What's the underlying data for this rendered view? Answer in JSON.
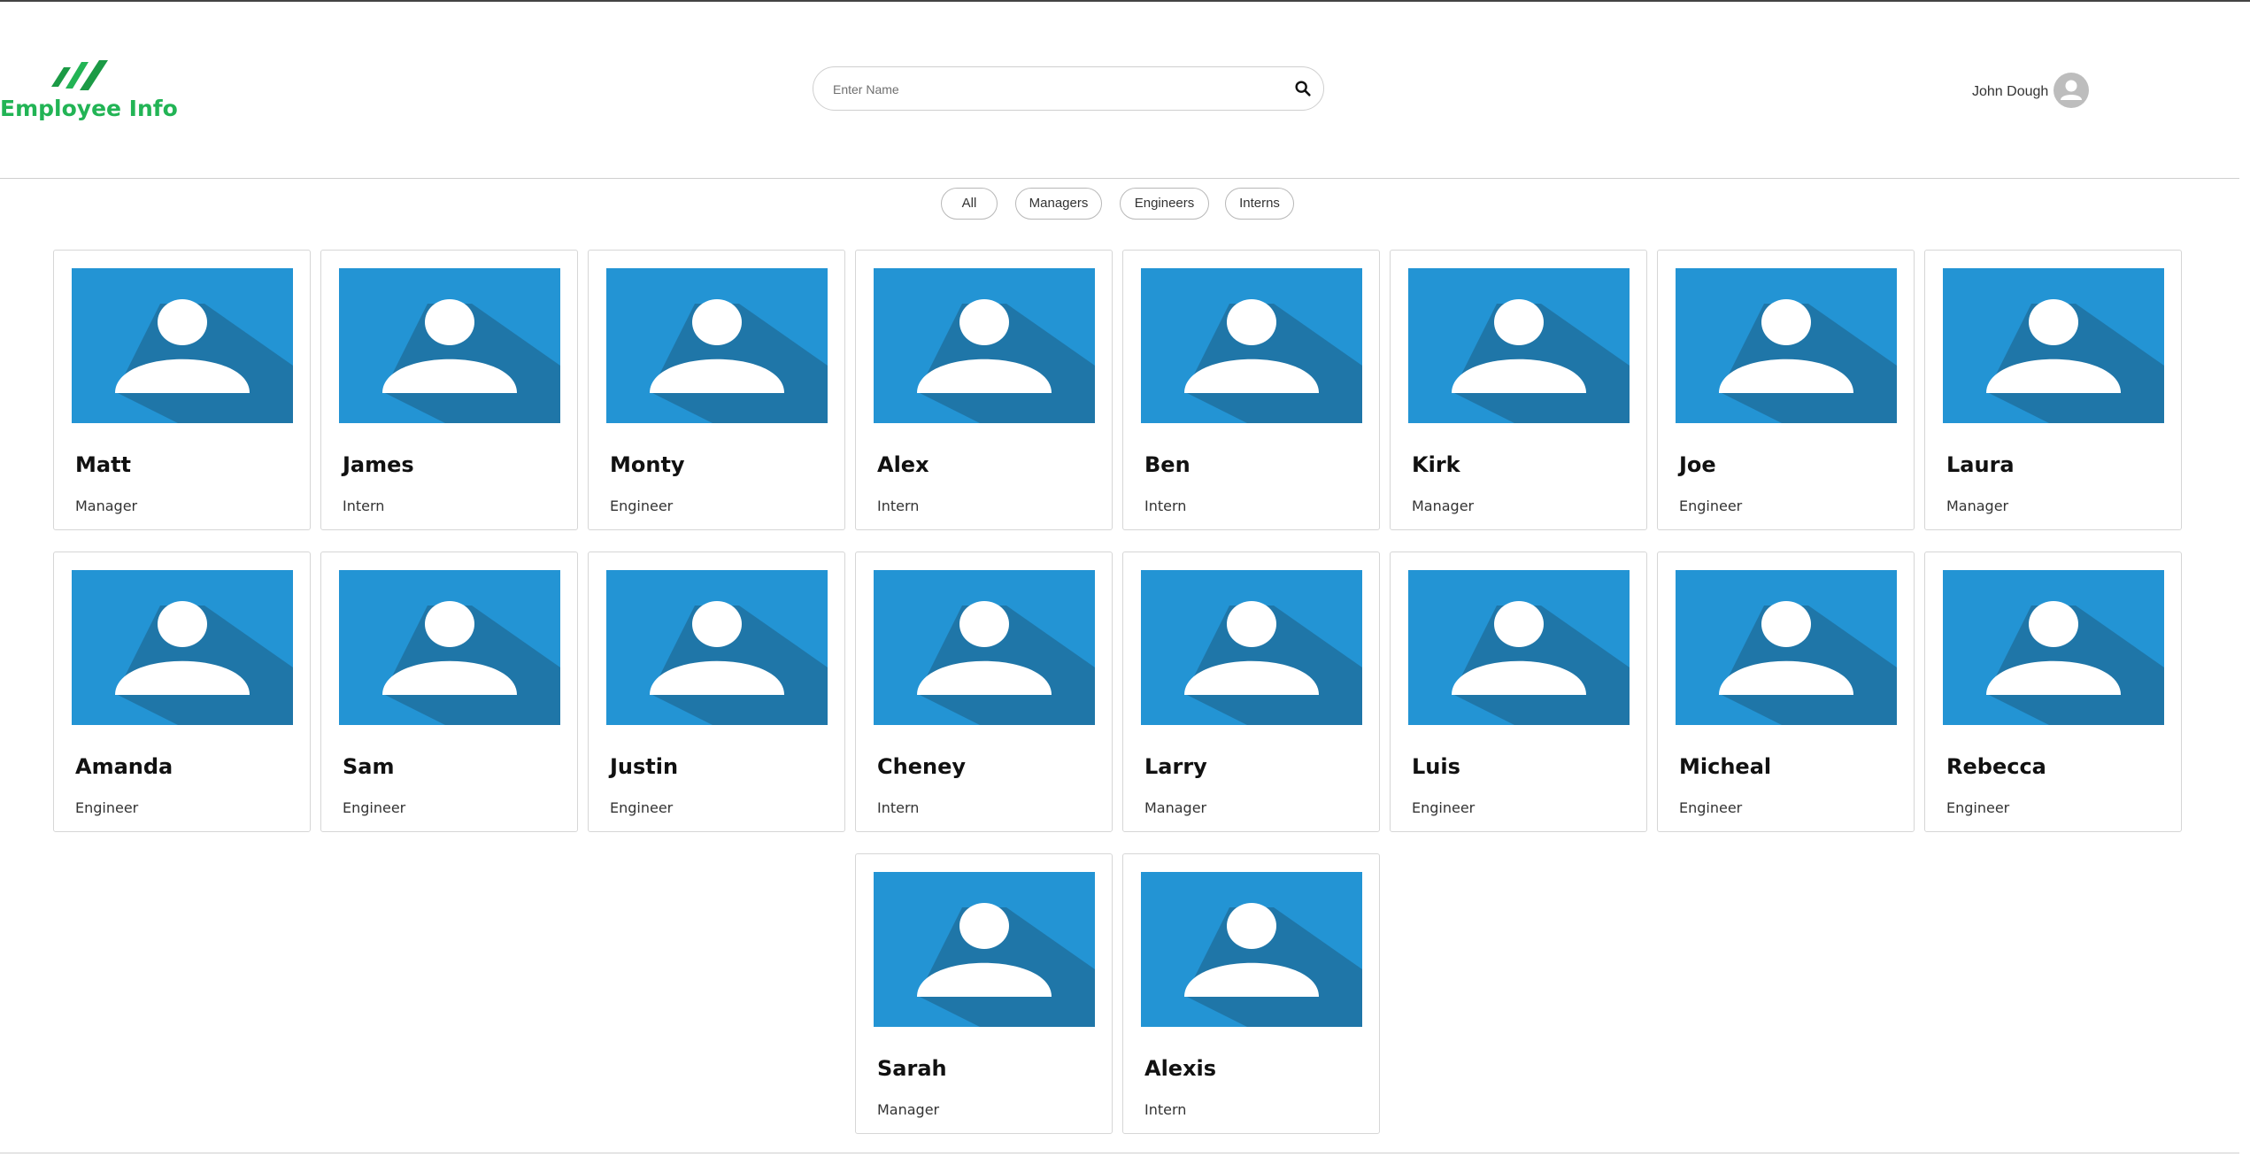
{
  "header": {
    "brand": "Employee Info",
    "search_placeholder": "Enter Name",
    "user_name": "John Dough"
  },
  "filters": [
    "All",
    "Managers",
    "Engineers",
    "Interns"
  ],
  "employees": [
    {
      "name": "Matt",
      "role": "Manager"
    },
    {
      "name": "James",
      "role": "Intern"
    },
    {
      "name": "Monty",
      "role": "Engineer"
    },
    {
      "name": "Alex",
      "role": "Intern"
    },
    {
      "name": "Ben",
      "role": "Intern"
    },
    {
      "name": "Kirk",
      "role": "Manager"
    },
    {
      "name": "Joe",
      "role": "Engineer"
    },
    {
      "name": "Laura",
      "role": "Manager"
    },
    {
      "name": "Amanda",
      "role": "Engineer"
    },
    {
      "name": "Sam",
      "role": "Engineer"
    },
    {
      "name": "Justin",
      "role": "Engineer"
    },
    {
      "name": "Cheney",
      "role": "Intern"
    },
    {
      "name": "Larry",
      "role": "Manager"
    },
    {
      "name": "Luis",
      "role": "Engineer"
    },
    {
      "name": "Micheal",
      "role": "Engineer"
    },
    {
      "name": "Rebecca",
      "role": "Engineer"
    },
    {
      "name": "Sarah",
      "role": "Manager"
    },
    {
      "name": "Alexis",
      "role": "Intern"
    }
  ],
  "colors": {
    "brand": "#22b455",
    "avatar_bg": "#2394d4",
    "avatar_shadow": "#1f76a8"
  },
  "icons": {
    "logo": "stripes-logo-icon",
    "search": "search-icon",
    "user": "user-avatar-icon",
    "employee_photo": "person-placeholder-icon"
  }
}
